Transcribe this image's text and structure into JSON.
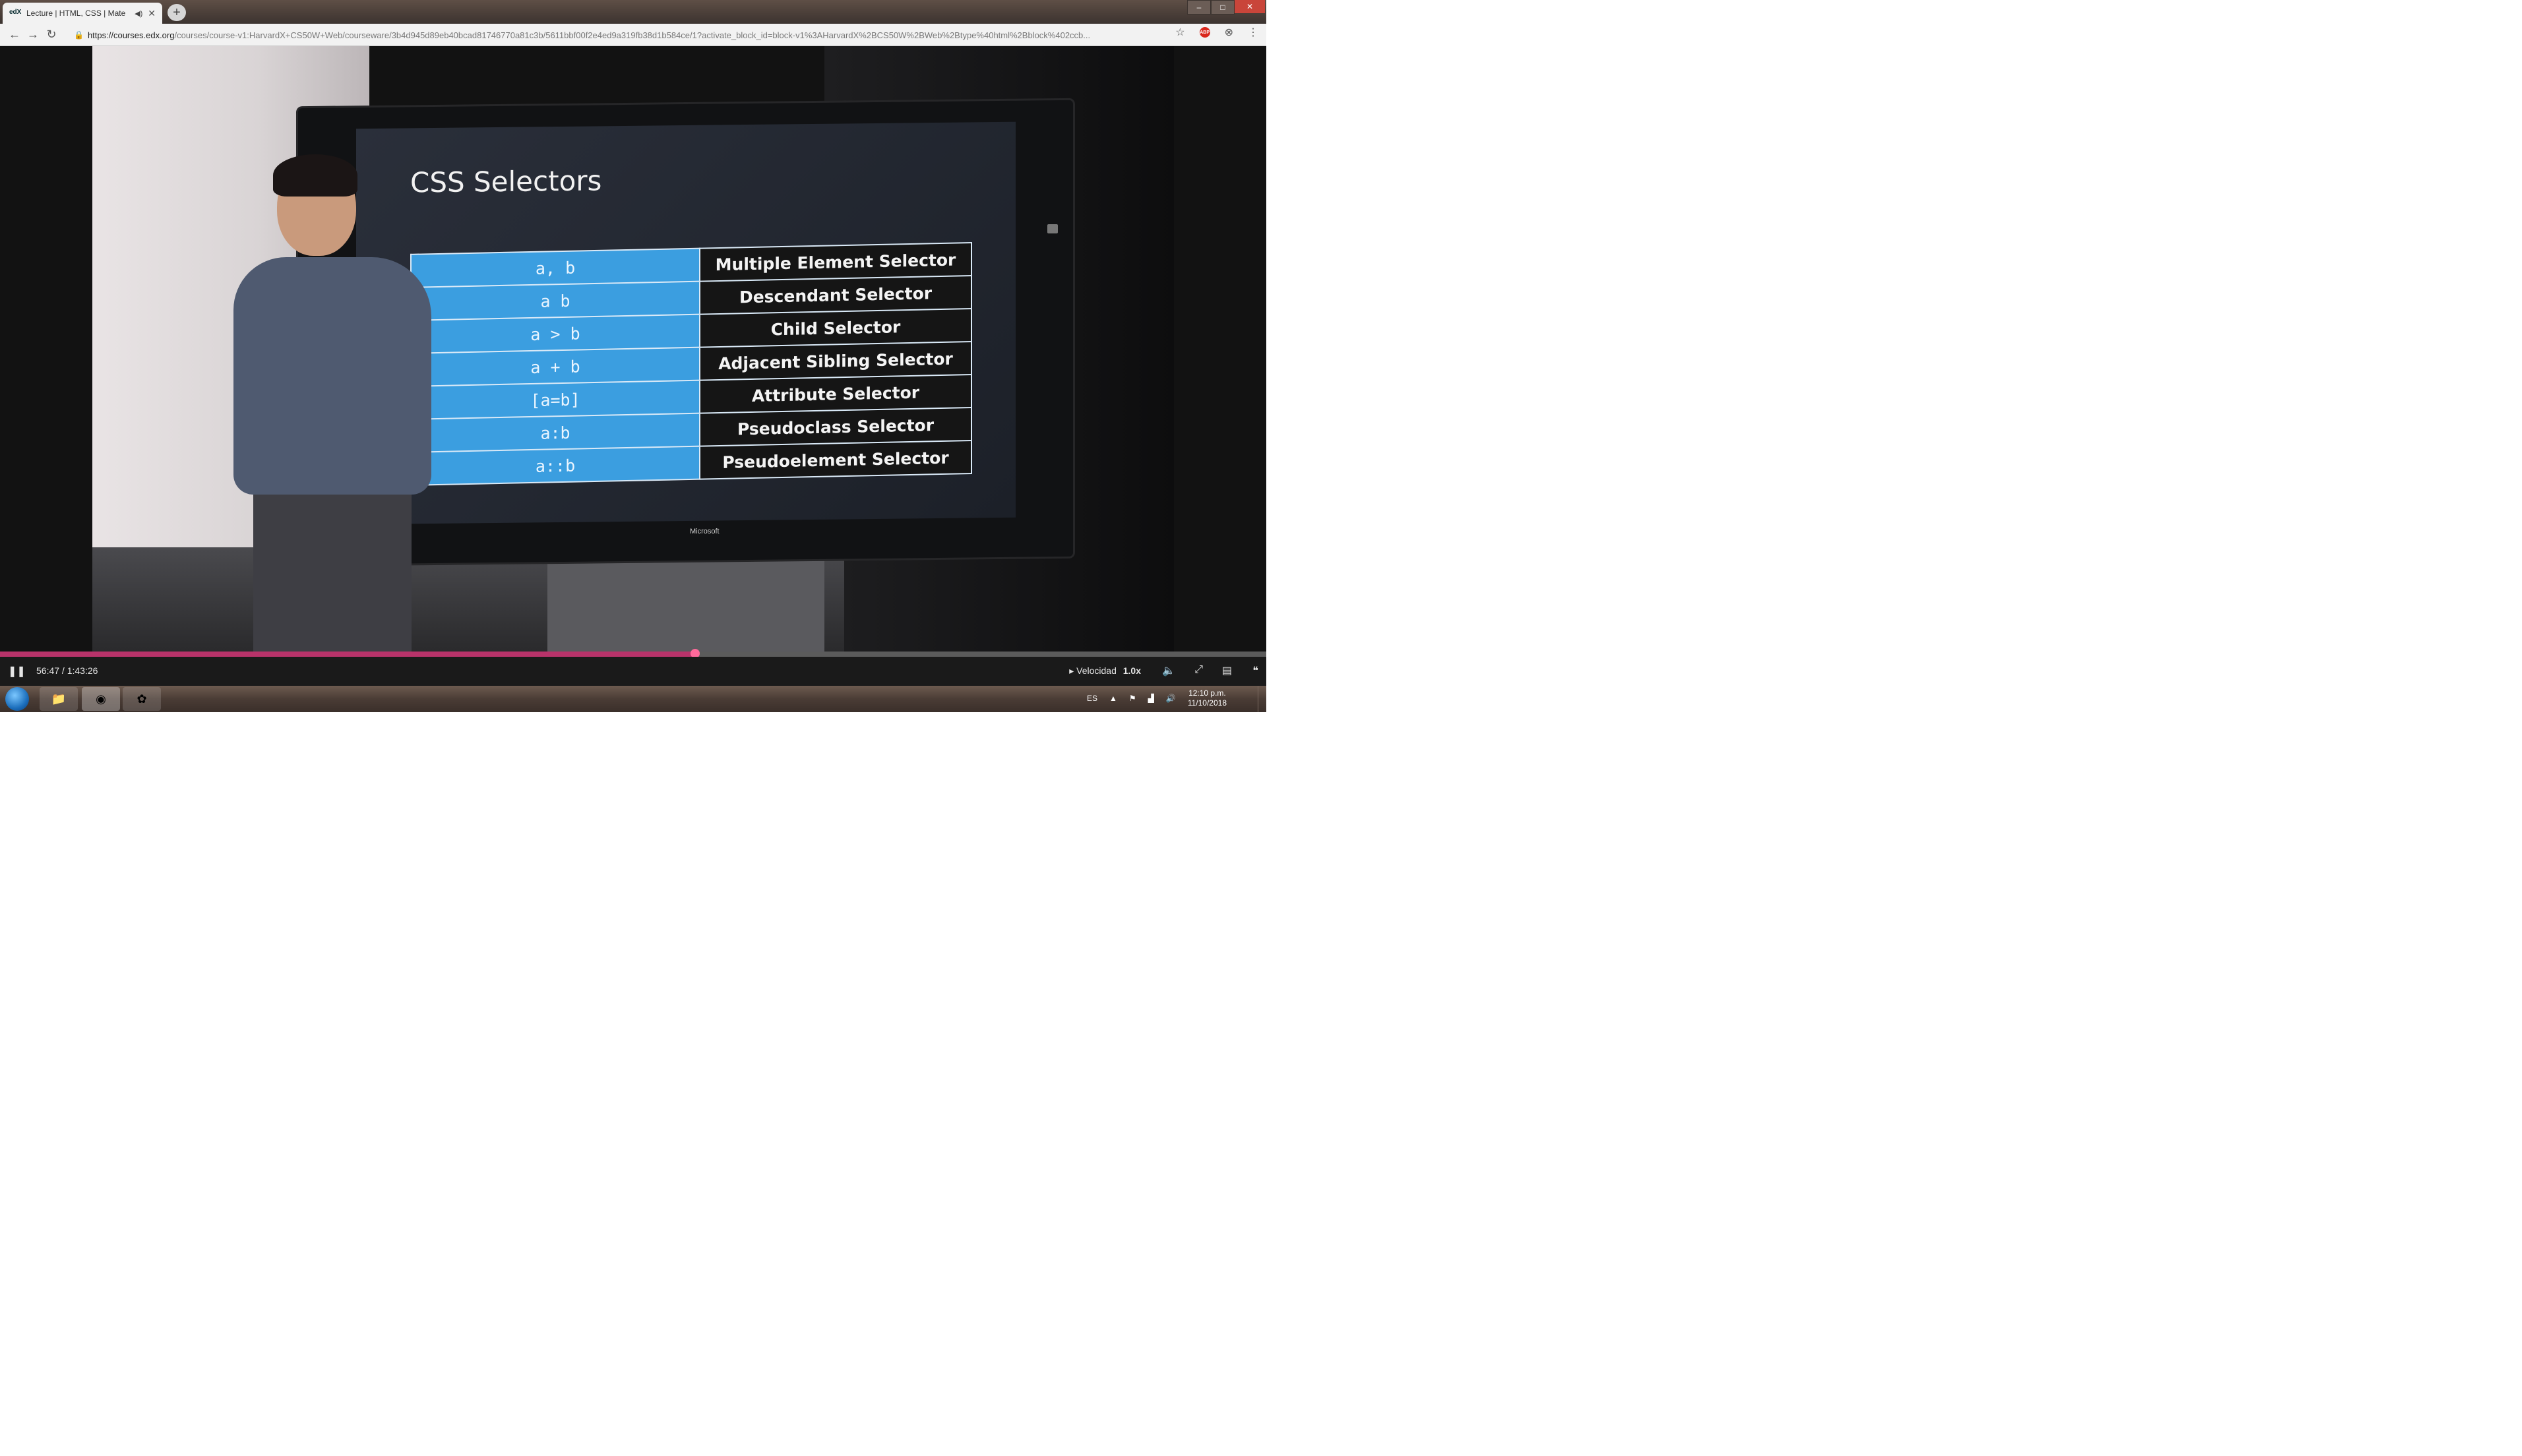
{
  "browser": {
    "tab_title": "Lecture | HTML, CSS | Mate",
    "favicon": "edX",
    "audio_icon": "speaker-icon",
    "url_host": "https://courses.edx.org",
    "url_path": "/courses/course-v1:HarvardX+CS50W+Web/courseware/3b4d945d89eb40bcad81746770a81c3b/5611bbf00f2e4ed9a319fb38d1b584ce/1?activate_block_id=block-v1%3AHarvardX%2BCS50W%2BWeb%2Btype%40html%2Bblock%402ccb...",
    "new_tab_label": "+",
    "window_controls": {
      "min": "–",
      "max": "□",
      "close": "✕"
    }
  },
  "video": {
    "slide_title": "CSS Selectors",
    "selectors": [
      {
        "selector": "a, b",
        "name": "Multiple Element Selector"
      },
      {
        "selector": "a b",
        "name": "Descendant Selector"
      },
      {
        "selector": "a > b",
        "name": "Child Selector"
      },
      {
        "selector": "a + b",
        "name": "Adjacent Sibling Selector"
      },
      {
        "selector": "[a=b]",
        "name": "Attribute Selector"
      },
      {
        "selector": "a:b",
        "name": "Pseudoclass Selector"
      },
      {
        "selector": "a::b",
        "name": "Pseudoelement Selector"
      }
    ],
    "tv_brand": "Microsoft"
  },
  "player": {
    "play_state_icon": "pause-icon",
    "time": "56:47 / 1:43:26",
    "progress_fraction": 0.549,
    "speed_label": "Velocidad",
    "speed_value": "1.0x"
  },
  "taskbar": {
    "language": "ES",
    "clock_time": "12:10 p.m.",
    "clock_date": "11/10/2018"
  },
  "colors": {
    "progress": "#b8336a",
    "slide_selector_cell": "#3b9ee0"
  }
}
